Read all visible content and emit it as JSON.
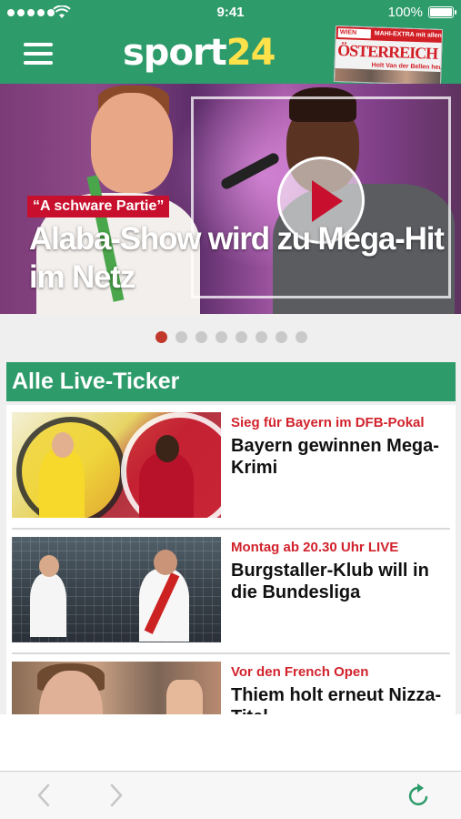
{
  "status_bar": {
    "time": "9:41",
    "battery": "100%"
  },
  "header": {
    "logo_part1": "sport",
    "logo_part2": "24",
    "epaper": {
      "top_left": "WIEN",
      "top_tag": "MAHI-EXTRA mit allen Ergebnissen aus Wien",
      "title": "ÖSTERREICH",
      "foot": "Holt Van der Bellen heute"
    }
  },
  "hero": {
    "kicker": "“A schware Partie”",
    "headline": "Alaba-Show wird zu Mega-Hit im Netz",
    "dot_count": 8,
    "active_dot": 1
  },
  "section": {
    "title": "Alle Live-Ticker",
    "items": [
      {
        "tag": "Sieg für Bayern im DFB-Pokal",
        "title": "Bayern gewinnen Mega-Krimi"
      },
      {
        "tag": "Montag ab 20.30 Uhr LIVE",
        "title": "Burgstaller-Klub will in die Bundesliga"
      },
      {
        "tag": "Vor den French Open",
        "title": "Thiem holt erneut Nizza-Titel"
      }
    ]
  },
  "colors": {
    "brand_green": "#2e9b6b",
    "logo_yellow": "#ffe14a",
    "accent_red": "#d2222c",
    "dot_active": "#c0392b",
    "dot_inactive": "#c9c9c9"
  },
  "icons": {
    "menu": "hamburger-menu-icon",
    "back": "chevron-left-icon",
    "forward": "chevron-right-icon",
    "reload": "reload-icon",
    "play": "play-icon"
  }
}
